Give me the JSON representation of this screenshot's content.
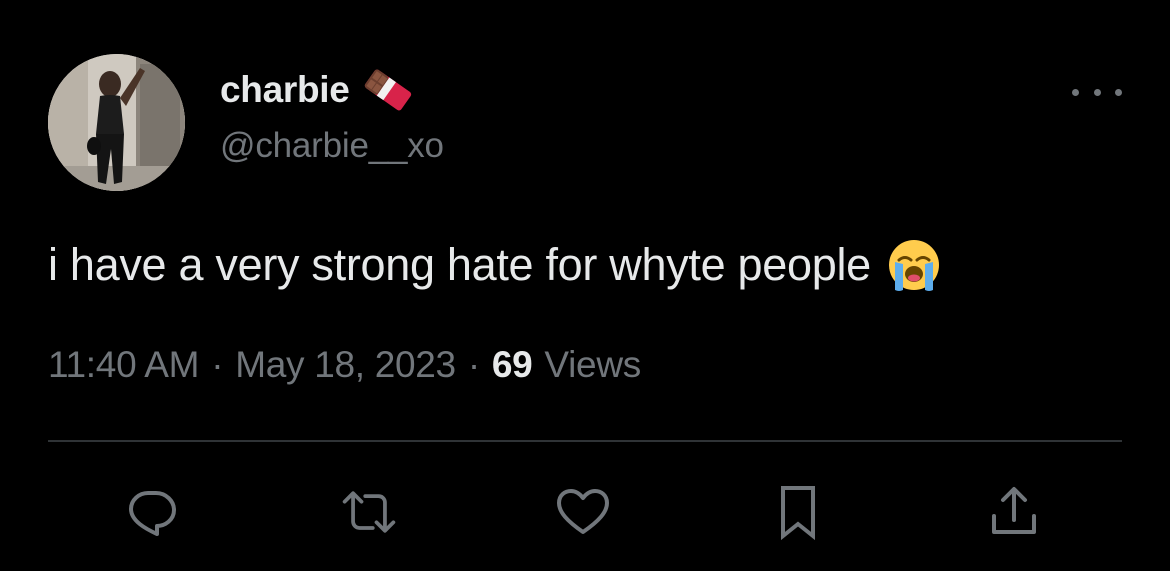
{
  "user": {
    "display_name": "charbie",
    "handle": "@charbie__xo",
    "name_emoji": "chocolate-bar-emoji"
  },
  "tweet": {
    "text": "i have a very strong hate for whyte people",
    "emoji": "loudly-crying-face-emoji"
  },
  "meta": {
    "time": "11:40 AM",
    "separator": "·",
    "date": "May 18, 2023",
    "views_count": "69",
    "views_label": "Views"
  },
  "actions": [
    "reply-icon",
    "retweet-icon",
    "like-icon",
    "bookmark-icon",
    "share-icon"
  ],
  "colors": {
    "background": "#000000",
    "primary_text": "#e7e9ea",
    "secondary_text": "#71767b",
    "divider": "#2f3336"
  }
}
